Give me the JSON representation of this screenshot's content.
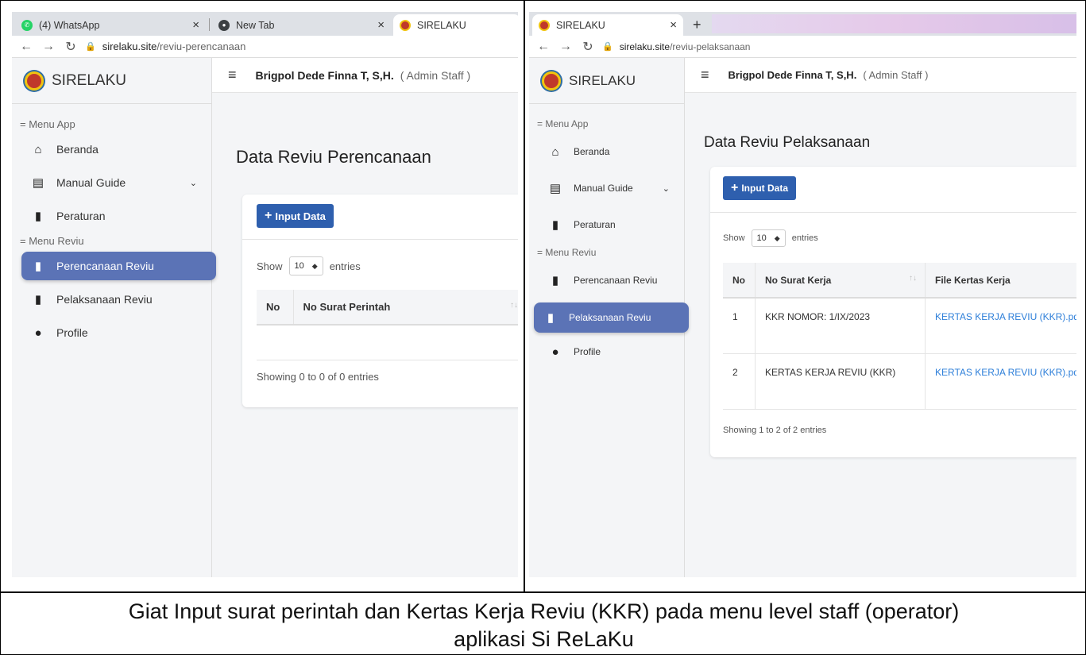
{
  "left": {
    "tabs": [
      {
        "label": "(4) WhatsApp",
        "icon": "whatsapp-icon"
      },
      {
        "label": "New Tab",
        "icon": "chrome-icon"
      },
      {
        "label": "SIRELAKU",
        "icon": "shield-icon"
      }
    ],
    "url_host": "sirelaku.site",
    "url_path": "/reviu-perencanaan",
    "brand": "SIRELAKU",
    "user_name": "Brigpol Dede Finna T, S,H.",
    "user_role": "( Admin Staff )",
    "section_app": "= Menu App",
    "section_reviu": "= Menu Reviu",
    "menu": {
      "beranda": "Beranda",
      "manual_guide": "Manual Guide",
      "peraturan": "Peraturan",
      "perencanaan": "Perencanaan Reviu",
      "pelaksanaan": "Pelaksanaan Reviu",
      "profile": "Profile"
    },
    "page_title": "Data Reviu Perencanaan",
    "input_button": "Input Data",
    "show_label": "Show",
    "entries_value": "10",
    "entries_label": "entries",
    "columns": [
      "No",
      "No Surat Perintah"
    ],
    "showing": "Showing 0 to 0 of 0 entries"
  },
  "right": {
    "tabs": [
      {
        "label": "SIRELAKU",
        "icon": "shield-icon"
      }
    ],
    "url_host": "sirelaku.site",
    "url_path": "/reviu-pelaksanaan",
    "brand": "SIRELAKU",
    "user_name": "Brigpol Dede Finna T, S,H.",
    "user_role": "( Admin Staff )",
    "section_app": "= Menu App",
    "section_reviu": "= Menu Reviu",
    "menu": {
      "beranda": "Beranda",
      "manual_guide": "Manual Guide",
      "peraturan": "Peraturan",
      "perencanaan": "Perencanaan Reviu",
      "pelaksanaan": "Pelaksanaan Reviu",
      "profile": "Profile"
    },
    "page_title": "Data Reviu Pelaksanaan",
    "input_button": "Input Data",
    "show_label": "Show",
    "entries_value": "10",
    "entries_label": "entries",
    "columns": [
      "No",
      "No Surat Kerja",
      "File Kertas Kerja"
    ],
    "rows": [
      {
        "no": "1",
        "surat": "KKR NOMOR: 1/IX/2023",
        "file": "KERTAS KERJA REVIU (KKR).pdf"
      },
      {
        "no": "2",
        "surat": "KERTAS KERJA REVIU (KKR)",
        "file": "KERTAS KERJA REVIU (KKR).pdf"
      }
    ],
    "showing": "Showing 1 to 2 of 2 entries"
  },
  "caption_line1": "Giat Input surat perintah dan Kertas Kerja Reviu (KKR) pada menu level staff (operator)",
  "caption_line2": "aplikasi Si ReLaKu",
  "colors": {
    "active_menu": "#5b73b6",
    "button": "#2e5fae",
    "link": "#2e7fd9"
  }
}
